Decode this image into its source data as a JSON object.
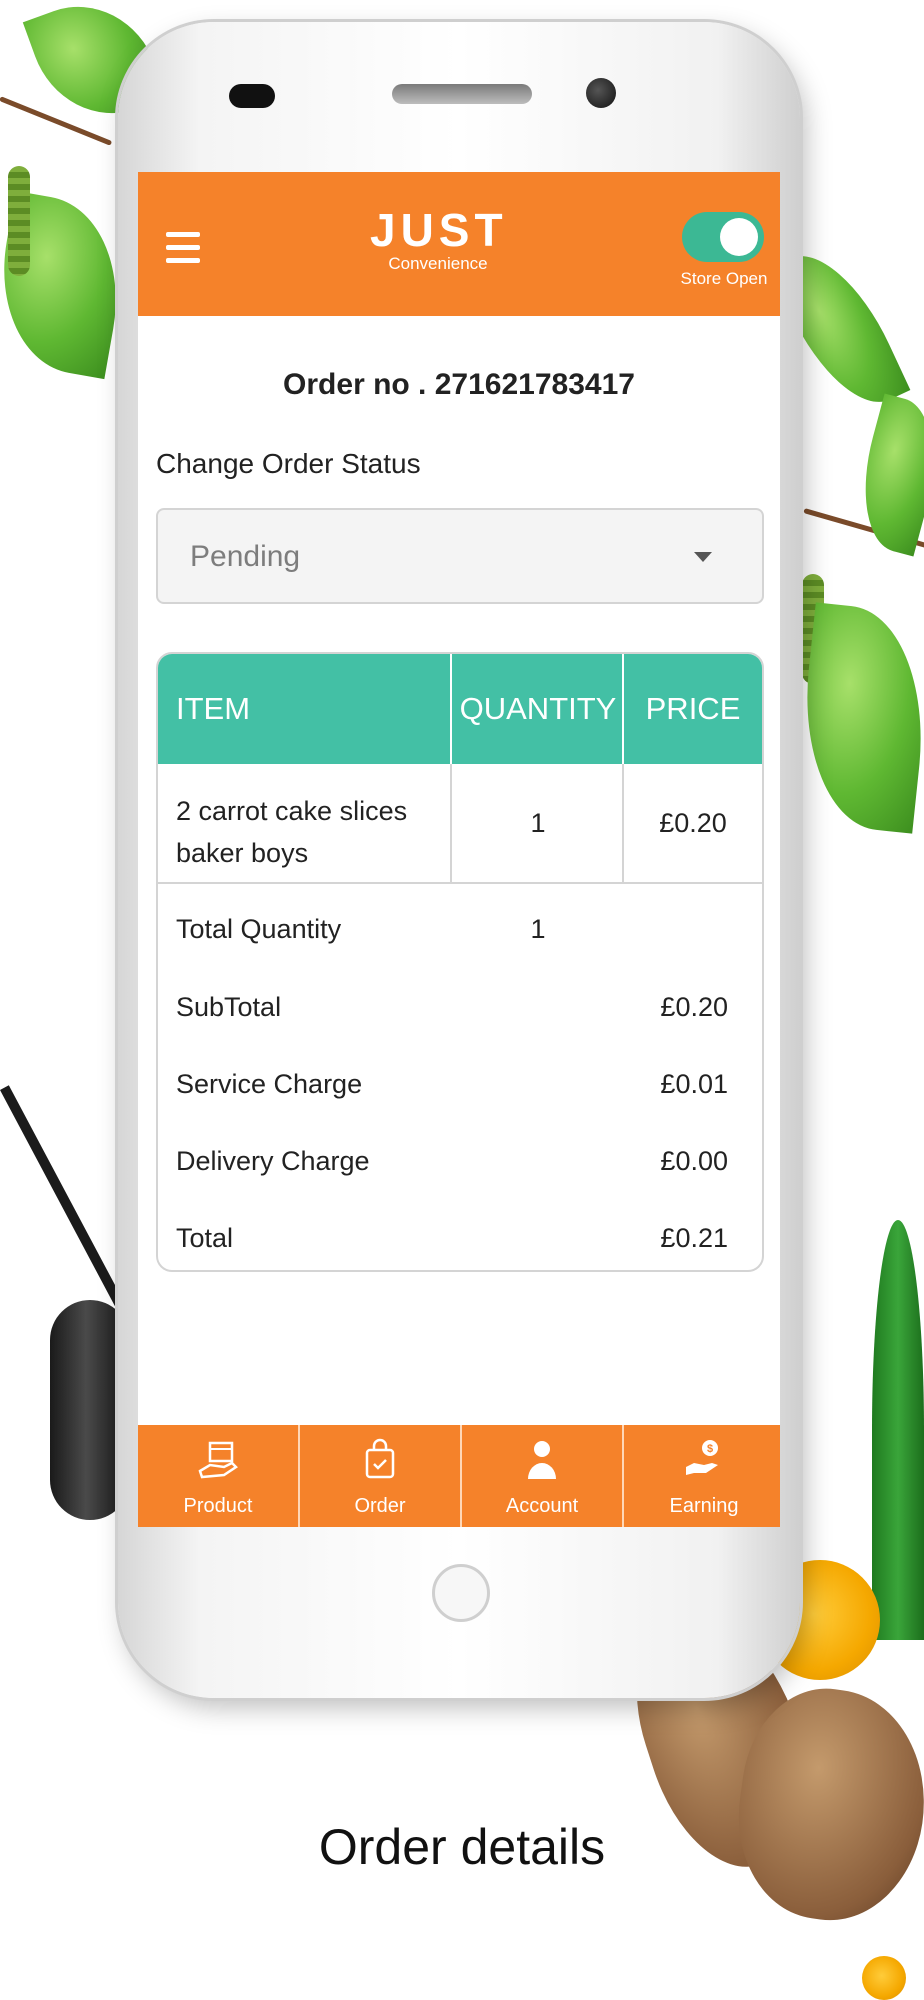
{
  "header": {
    "logo_main": "JUST",
    "logo_sub": "Convenience",
    "store_toggle_label": "Store Open",
    "store_open": true
  },
  "order": {
    "title": "Order no . 271621783417",
    "status_label": "Change Order Status",
    "status_value": "Pending"
  },
  "table": {
    "headers": [
      "ITEM",
      "QUANTITY",
      "PRICE"
    ],
    "items": [
      {
        "name": "2 carrot cake slices baker boys",
        "quantity": "1",
        "price": "£0.20"
      }
    ]
  },
  "summary": {
    "total_quantity_label": "Total Quantity",
    "total_quantity_value": "1",
    "subtotal_label": "SubTotal",
    "subtotal_value": "£0.20",
    "service_label": "Service Charge",
    "service_value": "£0.01",
    "delivery_label": "Delivery Charge",
    "delivery_value": "£0.00",
    "total_label": "Total",
    "total_value": "£0.21"
  },
  "bottom_nav": {
    "items": [
      {
        "label": "Product",
        "icon": "product-box-icon"
      },
      {
        "label": "Order",
        "icon": "shopping-bag-icon"
      },
      {
        "label": "Account",
        "icon": "user-icon"
      },
      {
        "label": "Earning",
        "icon": "earning-hand-icon"
      }
    ]
  },
  "caption": "Order details",
  "colors": {
    "brand_orange": "#f5822a",
    "table_header_teal": "#43c0a5",
    "toggle_green": "#3cb894"
  }
}
